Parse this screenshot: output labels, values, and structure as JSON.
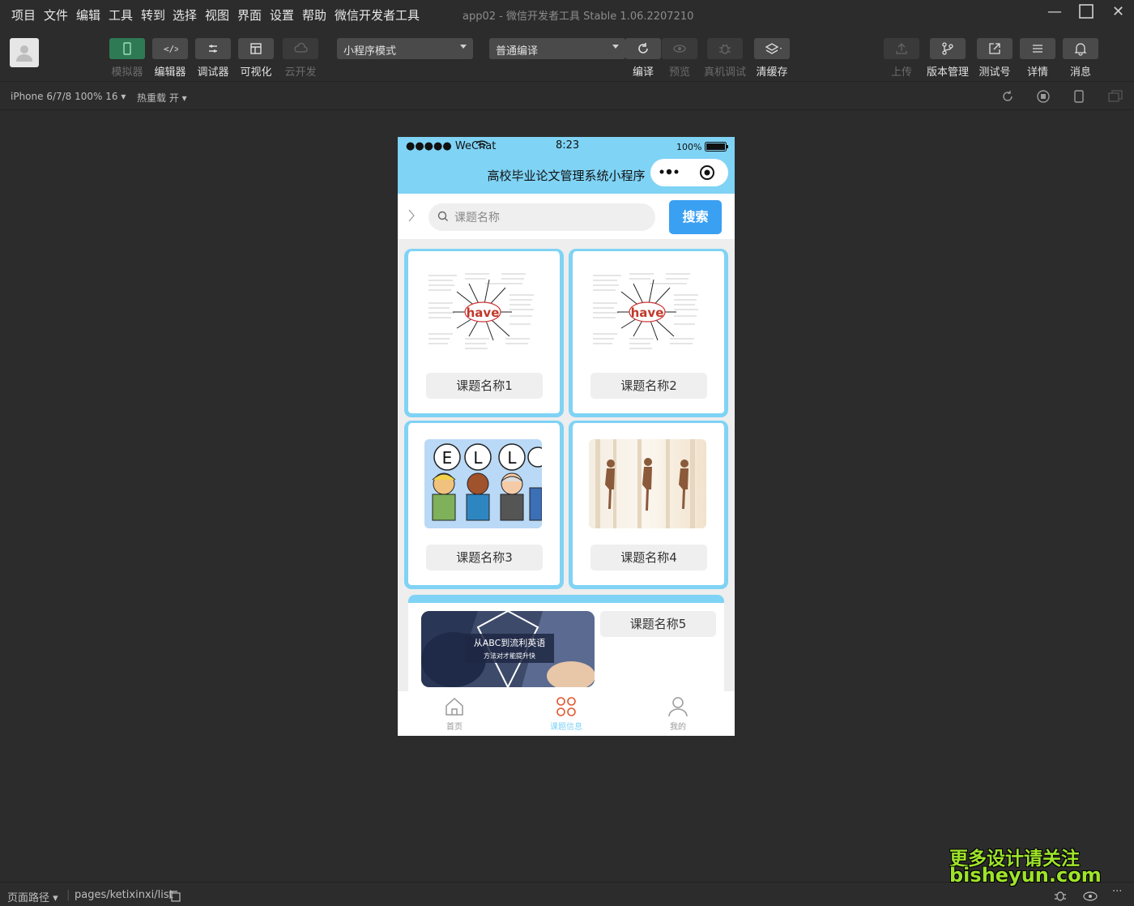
{
  "menu": [
    "项目",
    "文件",
    "编辑",
    "工具",
    "转到",
    "选择",
    "视图",
    "界面",
    "设置",
    "帮助",
    "微信开发者工具"
  ],
  "window_title": "app02 - 微信开发者工具 Stable 1.06.2207210",
  "toolbar": {
    "simulator": "模拟器",
    "editor": "编辑器",
    "debugger": "调试器",
    "visual": "可视化",
    "cloud": "云开发",
    "mode_select": "小程序模式",
    "compile_select": "普通编译",
    "compile": "编译",
    "preview": "预览",
    "remote_debug": "真机调试",
    "clear_cache": "清缓存",
    "upload": "上传",
    "version": "版本管理",
    "test": "测试号",
    "details": "详情",
    "messages": "消息"
  },
  "subbar": {
    "device": "iPhone 6/7/8 100% 16 ▾",
    "hotreload": "热重载 开 ▾"
  },
  "phone": {
    "status": {
      "carrier": "●●●●● WeChat",
      "time": "8:23",
      "battery": "100%"
    },
    "nav_title": "高校毕业论文管理系统小程序",
    "search": {
      "placeholder": "课题名称",
      "button": "搜索"
    },
    "cards": [
      {
        "title": "课题名称1",
        "image": "have-mindmap"
      },
      {
        "title": "课题名称2",
        "image": "have-mindmap"
      },
      {
        "title": "课题名称3",
        "image": "hello-cartoon"
      },
      {
        "title": "课题名称4",
        "image": "yoga-photo"
      }
    ],
    "wide_card": {
      "title": "课题名称5",
      "banner_line1": "从ABC到流利英语",
      "banner_line2": "方法对才能提升快"
    },
    "mindmap_word": "have",
    "tabs": [
      {
        "label": "首页",
        "icon": "home-icon"
      },
      {
        "label": "课题信息",
        "icon": "grid-icon"
      },
      {
        "label": "我的",
        "icon": "user-icon"
      }
    ]
  },
  "bottombar": {
    "path_label": "页面路径 ▾",
    "path": "pages/ketixinxi/list"
  },
  "watermark": {
    "line1": "更多设计请关注",
    "line2": "bisheyun.com"
  }
}
